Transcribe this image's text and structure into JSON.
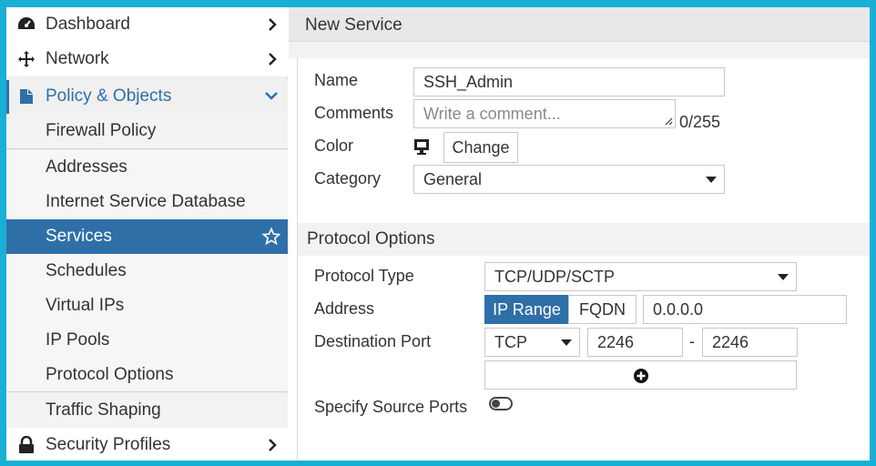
{
  "sidebar": {
    "items": [
      {
        "label": "Dashboard",
        "icon": "dashboard-icon"
      },
      {
        "label": "Network",
        "icon": "network-move-icon"
      },
      {
        "label": "Policy & Objects",
        "icon": "policy-objects-icon"
      },
      {
        "label": "Firewall Policy"
      },
      {
        "label": "Addresses"
      },
      {
        "label": "Internet Service Database"
      },
      {
        "label": "Services"
      },
      {
        "label": "Schedules"
      },
      {
        "label": "Virtual IPs"
      },
      {
        "label": "IP Pools"
      },
      {
        "label": "Protocol Options"
      },
      {
        "label": "Traffic Shaping"
      },
      {
        "label": "Security Profiles",
        "icon": "lock-icon"
      }
    ]
  },
  "page": {
    "title": "New Service"
  },
  "form": {
    "name_label": "Name",
    "name_value": "SSH_Admin",
    "comments_label": "Comments",
    "comments_placeholder": "Write a comment...",
    "comments_counter": "0/255",
    "color_label": "Color",
    "color_change_label": "Change",
    "category_label": "Category",
    "category_value": "General"
  },
  "protocol": {
    "section_title": "Protocol Options",
    "type_label": "Protocol Type",
    "type_value": "TCP/UDP/SCTP",
    "address_label": "Address",
    "address_mode_ip_range": "IP Range",
    "address_mode_fqdn": "FQDN",
    "address_value": "0.0.0.0",
    "dest_port_label": "Destination Port",
    "dest_port_protocol": "TCP",
    "dest_port_low": "2246",
    "dest_port_dash": "-",
    "dest_port_high": "2246",
    "source_ports_label": "Specify Source Ports"
  },
  "colors": {
    "accent": "#2f6fa8",
    "frame": "#1ab0d6"
  }
}
